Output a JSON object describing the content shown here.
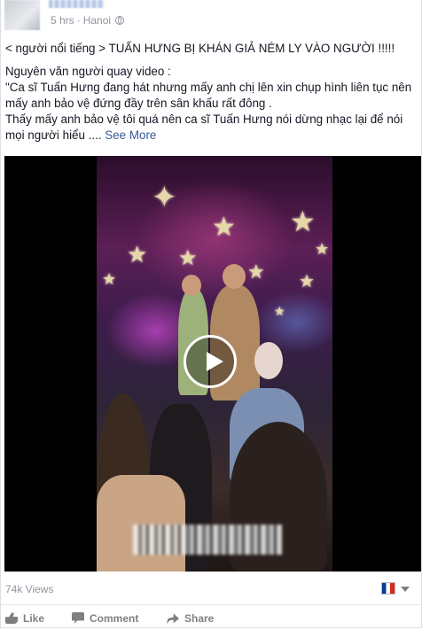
{
  "post": {
    "meta": {
      "time": "5 hrs",
      "location": "Hanoi",
      "privacy_icon": "globe-icon"
    },
    "text": {
      "line1": "< người nổi tiếng > TUẤN HƯNG BỊ KHÁN GIẢ NÉM LY VÀO NGƯỜI !!!!!",
      "line2": "Nguyên văn người quay video :",
      "line3": "\"Ca sĩ Tuấn Hưng đang hát nhưng mấy anh chị lên xin chụp hình liên tục nên mấy anh bảo vệ đứng đầy trên sân khấu rất đông .",
      "line4": "Thấy mấy anh bảo vệ tôi quá nên ca sĩ Tuấn Hưng nói dừng nhạc lại để nói mọi người hiểu ....",
      "see_more": "See More"
    },
    "video": {
      "play_icon": "play-icon"
    },
    "stats": {
      "views": "74k Views",
      "reaction_icon": "flag-icon"
    },
    "actions": [
      {
        "label": "Like",
        "icon": "like-icon"
      },
      {
        "label": "Comment",
        "icon": "comment-icon"
      },
      {
        "label": "Share",
        "icon": "share-icon"
      }
    ]
  },
  "colors": {
    "link": "#365899",
    "meta": "#90949c",
    "text": "#141823"
  }
}
